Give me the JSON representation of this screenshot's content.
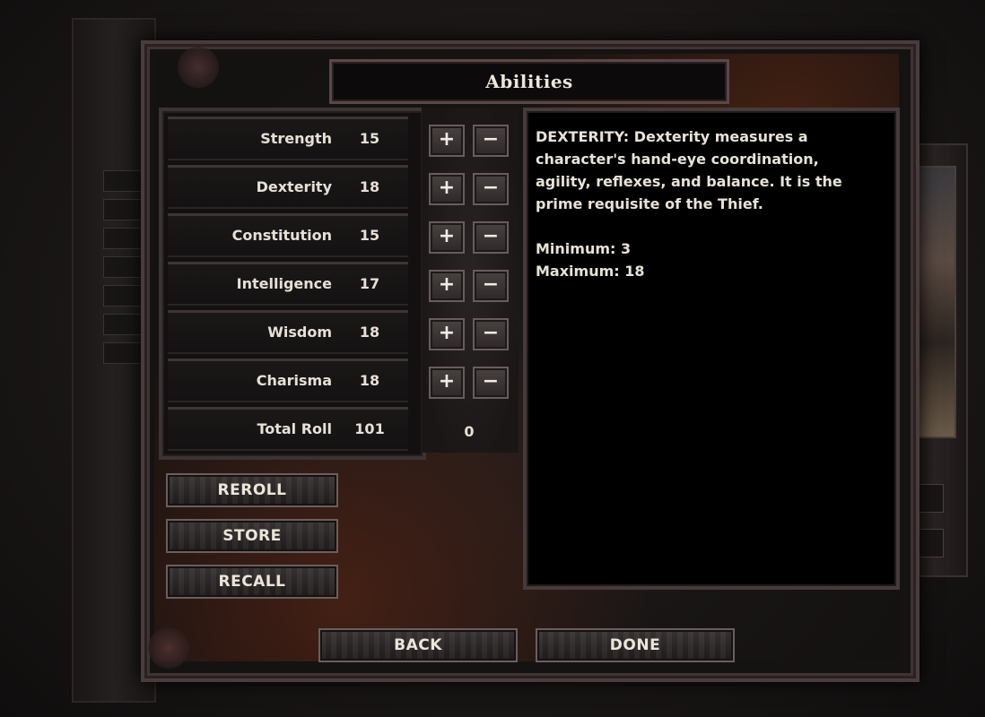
{
  "title": "Abilities",
  "abilities": [
    {
      "name": "Strength",
      "value": "15"
    },
    {
      "name": "Dexterity",
      "value": "18"
    },
    {
      "name": "Constitution",
      "value": "15"
    },
    {
      "name": "Intelligence",
      "value": "17"
    },
    {
      "name": "Wisdom",
      "value": "18"
    },
    {
      "name": "Charisma",
      "value": "18"
    }
  ],
  "total": {
    "label": "Total Roll",
    "value": "101",
    "points_remaining": "0"
  },
  "controls": {
    "plus_glyph": "+",
    "minus_glyph": "−"
  },
  "description": {
    "text": "DEXTERITY: Dexterity measures a character's hand-eye coordination, agility, reflexes, and balance. It is the prime requisite of the Thief.",
    "minimum": "Minimum: 3",
    "maximum": "Maximum: 18"
  },
  "buttons": {
    "reroll": "REROLL",
    "store": "STORE",
    "recall": "RECALL",
    "back": "BACK",
    "done": "DONE"
  }
}
